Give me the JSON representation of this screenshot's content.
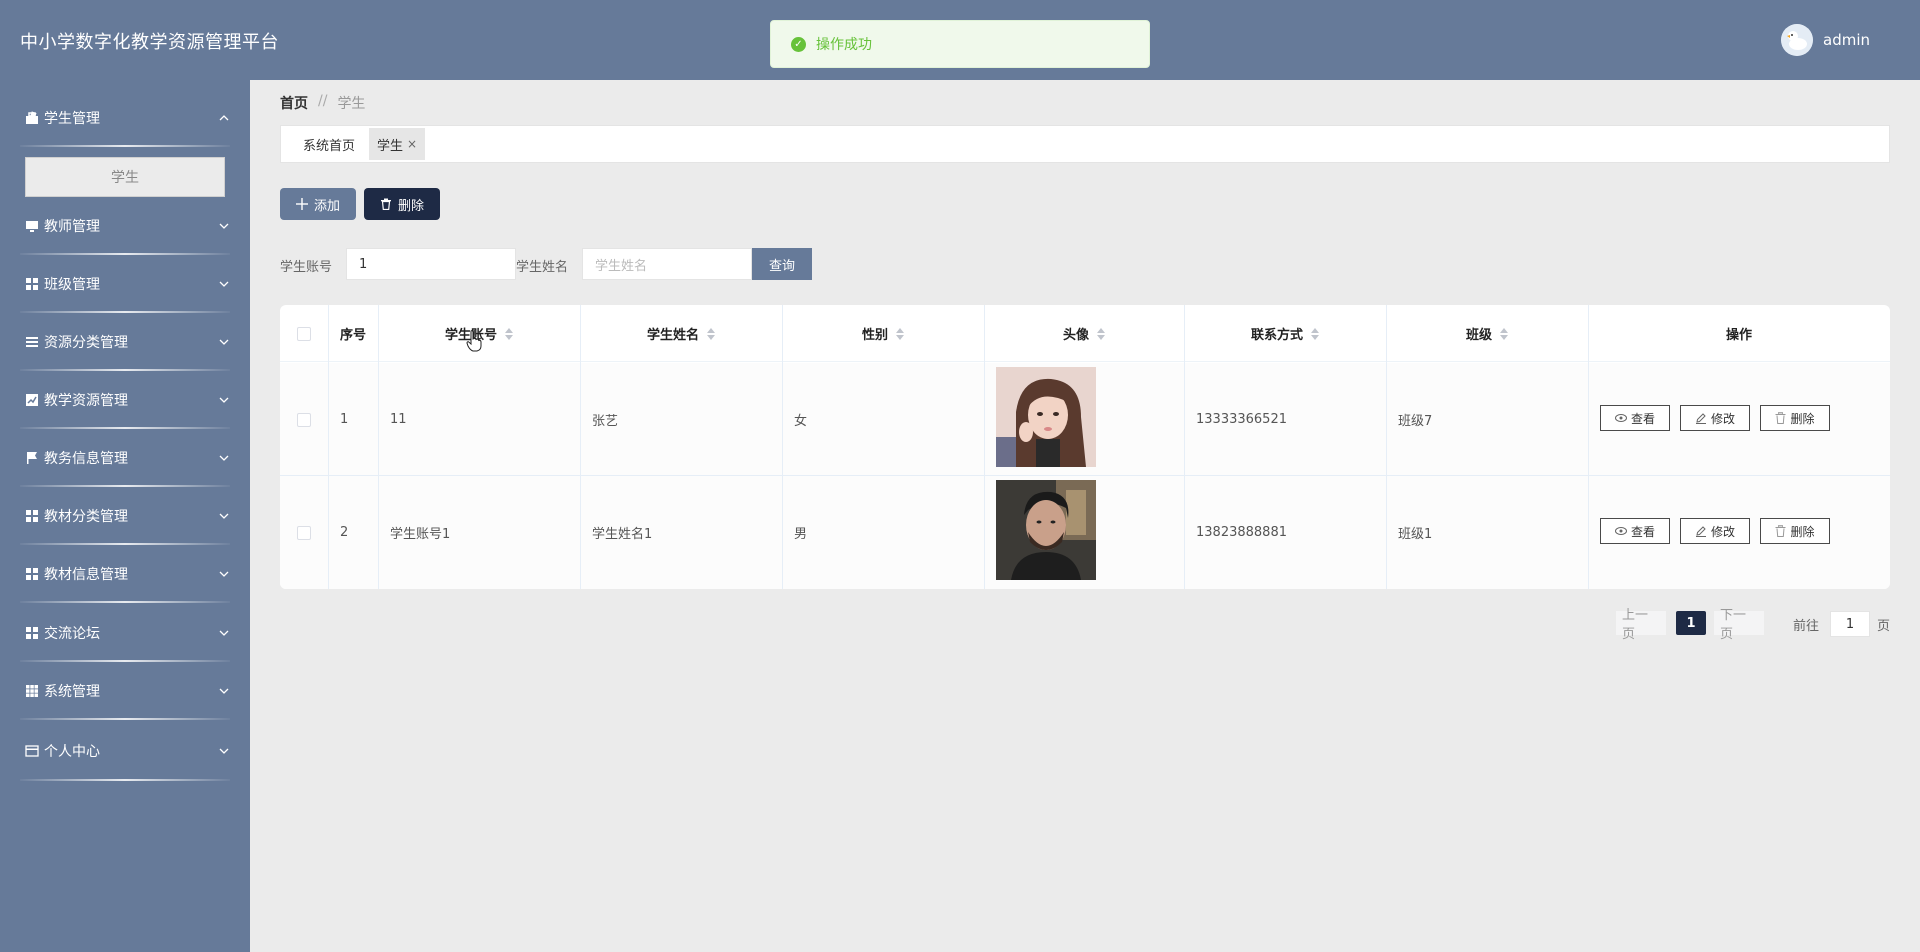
{
  "header": {
    "title": "中小学数字化教学资源管理平台",
    "username": "admin"
  },
  "toast": {
    "message": "操作成功"
  },
  "sidebar": {
    "items": [
      {
        "label": "学生管理",
        "icon": "briefcase-icon",
        "expanded": true
      },
      {
        "label": "教师管理",
        "icon": "monitor-icon"
      },
      {
        "label": "班级管理",
        "icon": "grid-icon"
      },
      {
        "label": "资源分类管理",
        "icon": "list-icon"
      },
      {
        "label": "教学资源管理",
        "icon": "chart-icon"
      },
      {
        "label": "教务信息管理",
        "icon": "flag-icon"
      },
      {
        "label": "教材分类管理",
        "icon": "grid-icon"
      },
      {
        "label": "教材信息管理",
        "icon": "grid-icon"
      },
      {
        "label": "交流论坛",
        "icon": "grid-icon"
      },
      {
        "label": "系统管理",
        "icon": "apps-icon"
      },
      {
        "label": "个人中心",
        "icon": "card-icon"
      }
    ],
    "submenu": {
      "label": "学生"
    }
  },
  "breadcrumb": {
    "home": "首页",
    "separator": "//",
    "current": "学生"
  },
  "tabs": [
    {
      "label": "系统首页"
    },
    {
      "label": "学生",
      "close": "×"
    }
  ],
  "toolbar": {
    "add_label": "添加",
    "delete_label": "删除"
  },
  "search": {
    "account_label": "学生账号",
    "account_value": "1",
    "name_label": "学生姓名",
    "name_placeholder": "学生姓名",
    "query_label": "查询"
  },
  "table": {
    "headers": {
      "index": "序号",
      "account": "学生账号",
      "name": "学生姓名",
      "gender": "性别",
      "avatar": "头像",
      "phone": "联系方式",
      "class": "班级",
      "actions": "操作"
    },
    "rows": [
      {
        "index": "1",
        "account": "11",
        "name": "张艺",
        "gender": "女",
        "phone": "13333366521",
        "class": "班级7"
      },
      {
        "index": "2",
        "account": "学生账号1",
        "name": "学生姓名1",
        "gender": "男",
        "phone": "13823888881",
        "class": "班级1"
      }
    ],
    "actions": {
      "view": "查看",
      "edit": "修改",
      "delete": "删除"
    }
  },
  "pagination": {
    "prev": "上一页",
    "current": "1",
    "next": "下一页",
    "goto_label": "前往",
    "goto_value": "1",
    "page_suffix": "页"
  },
  "colors": {
    "header_bg": "#667a99",
    "sidebar_bg": "#667a99",
    "dark_button": "#1e2a45",
    "success": "#67c23a"
  }
}
